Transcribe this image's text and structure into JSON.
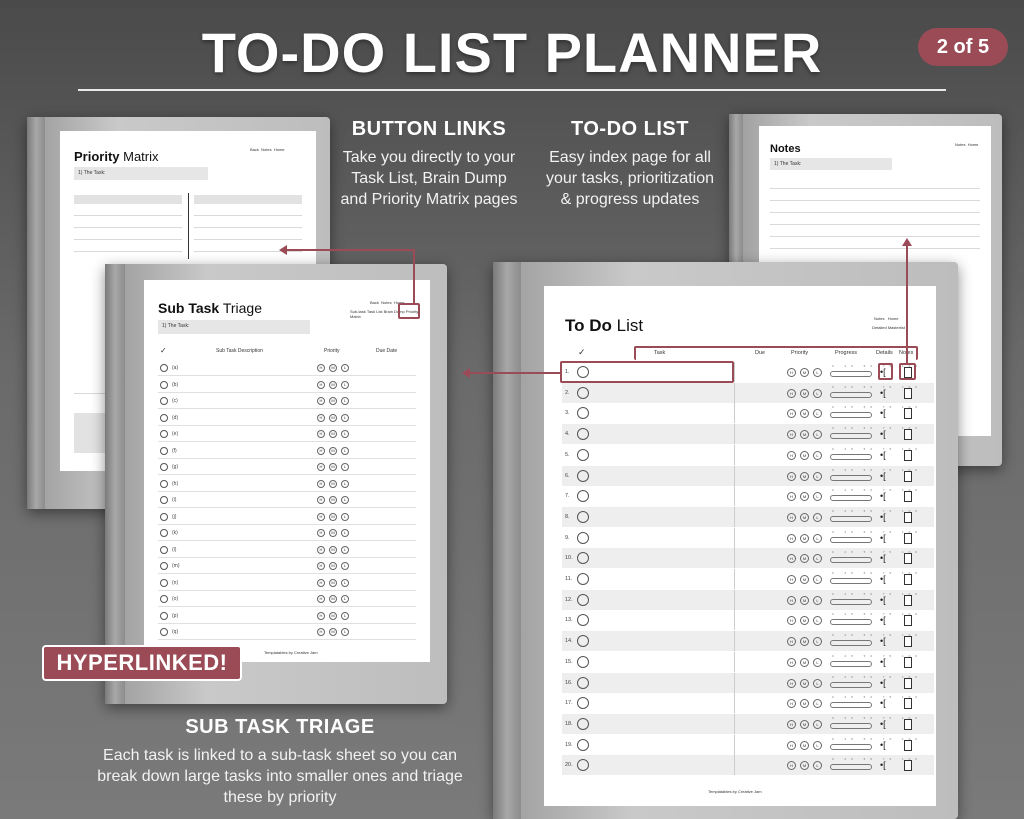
{
  "header": {
    "title": "TO-DO LIST PLANNER",
    "badge": "2 of 5"
  },
  "captions": {
    "button_links": {
      "heading": "BUTTON LINKS",
      "body": "Take you directly to your Task List, Brain Dump and Priority Matrix pages"
    },
    "todo_list": {
      "heading": "TO-DO LIST",
      "body": "Easy index page for all your tasks, prioritization & progress updates"
    },
    "sub_task": {
      "heading": "SUB TASK TRIAGE",
      "body": "Each task is linked to a sub-task sheet so you can break down large tasks into smaller ones and triage these by priority"
    }
  },
  "hyperlinked_label": "HYPERLINKED!",
  "priority_matrix": {
    "title_bold": "Priority",
    "title_rest": " Matrix",
    "task_label": "1) The Task:",
    "nav": [
      "Back",
      "Notes",
      "Home"
    ],
    "subnav": [
      "Sub-task Triage",
      "Task List",
      "Brain Dump"
    ]
  },
  "notes_page": {
    "title": "Notes",
    "task_label": "1) The Task:",
    "nav": [
      "Notes",
      "Home"
    ]
  },
  "sub_task": {
    "title_bold": "Sub Task",
    "title_rest": " Triage",
    "task_label": "1) The Task:",
    "nav": [
      "Back",
      "Notes",
      "Home"
    ],
    "subnav": [
      "Sub-task",
      "Task List",
      "Brain Dump",
      "Priority Matrix"
    ],
    "columns": [
      "✓",
      "Sub Task Description",
      "Priority",
      "Due Date"
    ],
    "rows": [
      "(a)",
      "(b)",
      "(c)",
      "(d)",
      "(e)",
      "(f)",
      "(g)",
      "(h)",
      "(i)",
      "(j)",
      "(k)",
      "(l)",
      "(m)",
      "(n)",
      "(o)",
      "(p)",
      "(q)"
    ],
    "priority": [
      "H",
      "M",
      "L"
    ],
    "footer": "Templatables by Creative Jam"
  },
  "todo": {
    "title_bold": "To Do",
    "title_rest": " List",
    "nav": [
      "Notes",
      "Home"
    ],
    "subnav": [
      "Detailed",
      "Masterlist"
    ],
    "columns": [
      "✓",
      "Task",
      "Due",
      "Priority",
      "Progress",
      "Details",
      "Notes"
    ],
    "rows": [
      "1.",
      "2.",
      "3.",
      "4.",
      "5.",
      "6.",
      "7.",
      "8.",
      "9.",
      "10.",
      "11.",
      "12.",
      "13.",
      "14.",
      "15.",
      "16.",
      "17.",
      "18.",
      "19.",
      "20."
    ],
    "priority": [
      "H",
      "M",
      "L"
    ],
    "progress_ticks": [
      "0",
      "25",
      "50",
      "75",
      "100"
    ],
    "footer": "Templatables by Creative Jam"
  },
  "colors": {
    "accent": "#9a4b56"
  }
}
